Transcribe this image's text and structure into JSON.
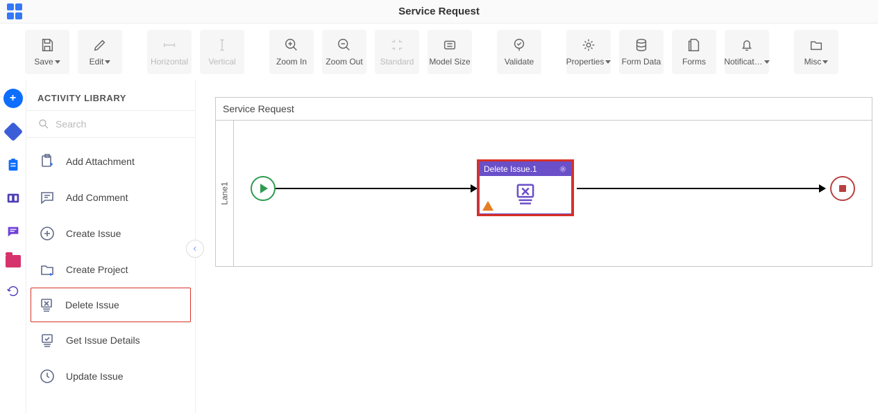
{
  "page": {
    "title": "Service Request"
  },
  "toolbar": {
    "save": "Save",
    "edit": "Edit",
    "horizontal": "Horizontal",
    "vertical": "Vertical",
    "zoom_in": "Zoom In",
    "zoom_out": "Zoom Out",
    "standard": "Standard",
    "model_size": "Model Size",
    "validate": "Validate",
    "properties": "Properties",
    "form_data": "Form Data",
    "forms": "Forms",
    "notifications": "Notificat…",
    "misc": "Misc"
  },
  "library": {
    "title": "ACTIVITY LIBRARY",
    "search_placeholder": "Search",
    "items": {
      "add_attachment": "Add Attachment",
      "add_comment": "Add Comment",
      "create_issue": "Create Issue",
      "create_project": "Create Project",
      "delete_issue": "Delete Issue",
      "get_issue_details": "Get Issue Details",
      "update_issue": "Update Issue"
    }
  },
  "canvas": {
    "pool_title": "Service Request",
    "lane_label": "Lane1",
    "task_label": "Delete Issue.1"
  }
}
